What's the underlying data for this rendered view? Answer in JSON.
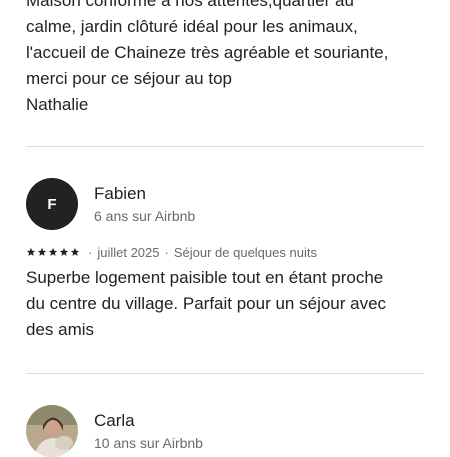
{
  "previous_review": {
    "lines": [
      "Maison conforme à nos attentes,quartier au",
      "calme, jardin clôturé idéal pour les animaux,",
      "l'accueil de Chaineze très agréable et souriante,",
      "merci pour ce séjour au  top",
      "Nathalie"
    ]
  },
  "reviews": [
    {
      "avatar_initial": "F",
      "name": "Fabien",
      "tenure": "6 ans sur Airbnb",
      "rating": 5,
      "date": "juillet 2025",
      "stay": "Séjour de quelques nuits",
      "lines": [
        "Superbe logement paisible tout en étant proche",
        "du centre du village. Parfait pour un séjour avec",
        "des amis"
      ]
    },
    {
      "name": "Carla",
      "tenure": "10 ans sur Airbnb"
    }
  ],
  "icons": {
    "star": "star-icon"
  },
  "colors": {
    "text": "#222222",
    "muted": "#6a6a6a",
    "divider": "#dddddd",
    "avatar_bg": "#222222"
  }
}
